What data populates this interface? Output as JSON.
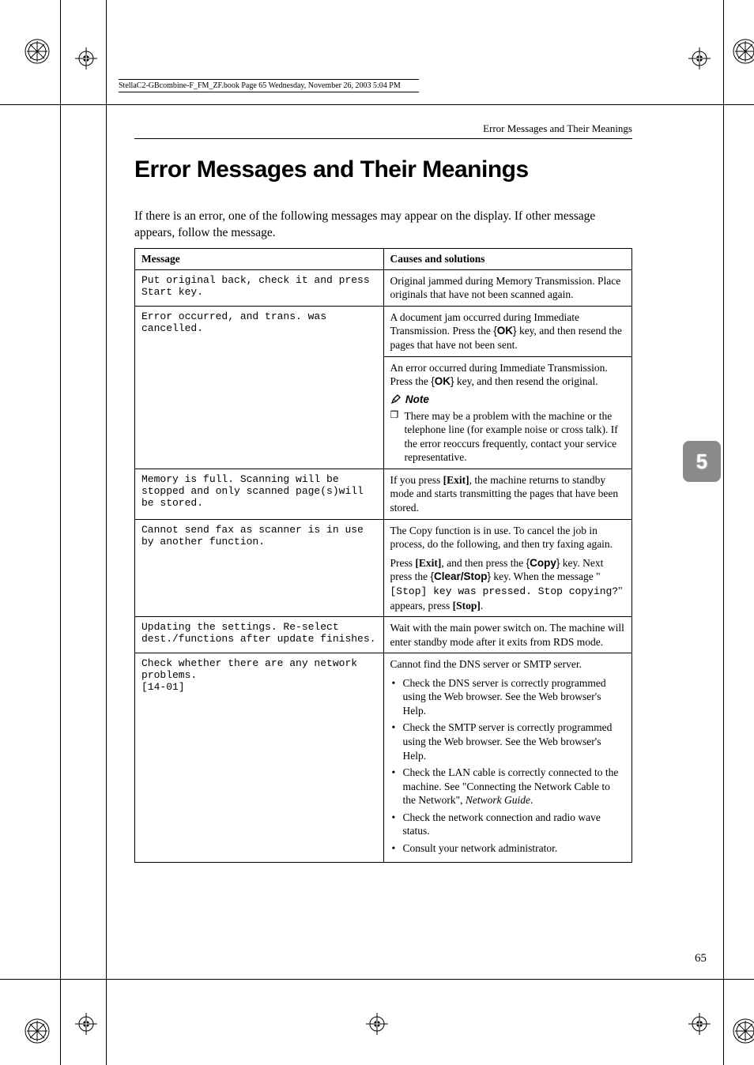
{
  "book_header": "StellaC2-GBcombine-F_FM_ZF.book  Page 65  Wednesday, November 26, 2003  5:04 PM",
  "running_head": "Error Messages and Their Meanings",
  "title": "Error Messages and Their Meanings",
  "intro": "If there is an error, one of the following messages may appear on the display. If other message appears, follow the message.",
  "side_tab": "5",
  "page_number": "65",
  "table": {
    "head_message": "Message",
    "head_causes": "Causes and solutions",
    "rows": [
      {
        "message": "Put original back, check it and press Start key.",
        "solution_paras": [
          "Original jammed during Memory Transmission. Place originals that have not been scanned again."
        ]
      },
      {
        "message": "Error occurred, and trans. was cancelled.",
        "rowgroup": [
          {
            "solution_paras": [
              "A document jam occurred during Immediate Transmission. Press the {OK} key, and then resend the pages that have not been sent."
            ]
          },
          {
            "solution_paras": [
              "An error occurred during Immediate Transmission. Press the {OK} key, and then resend the original."
            ],
            "note_label": "Note",
            "note_items": [
              "There may be a problem with the machine or the telephone line (for example noise or cross talk). If the error reoccurs frequently, contact your service representative."
            ]
          }
        ]
      },
      {
        "message": "Memory is full. Scanning will be stopped and only scanned page(s)will be stored.",
        "solution_paras": [
          "If you press [Exit], the machine returns to standby mode and starts transmitting the pages that have been stored."
        ]
      },
      {
        "message": "Cannot send fax as scanner is in use by another function.",
        "solution_paras": [
          "The Copy function is in use. To cancel the job in process, do the following, and then try faxing again.",
          "Press [Exit], and then press the {Copy} key. Next press the {Clear/Stop} key. When the message \"[Stop] key was pressed. Stop copying?\" appears, press [Stop]."
        ]
      },
      {
        "message": "Updating the settings. Re-select dest./functions after update finishes.",
        "solution_paras": [
          "Wait with the main power switch on. The machine will enter standby mode after it exits from RDS mode."
        ]
      },
      {
        "message_lines": [
          "Check whether there are any network problems.",
          "[14-01]"
        ],
        "solution_lead": "Cannot find the DNS server or SMTP server.",
        "solution_bullets": [
          "Check the DNS server is correctly programmed using the Web browser. See the Web browser's Help.",
          "Check the SMTP server is correctly programmed using the Web browser. See the Web browser's Help.",
          "Check the LAN cable is correctly connected to the machine. See \"Connecting the Network Cable to the Network\", Network Guide.",
          "Check the network connection and radio wave status.",
          "Consult your network administrator."
        ]
      }
    ]
  }
}
